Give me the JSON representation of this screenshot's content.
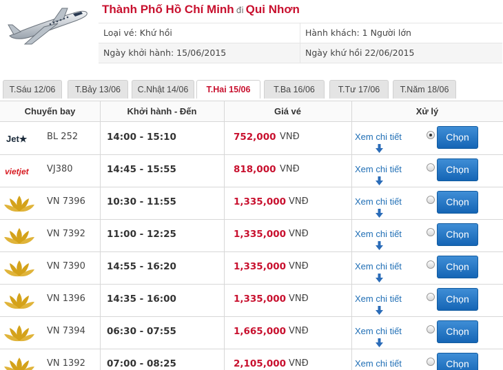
{
  "header": {
    "from_city": "Thành Phố Hồ Chí Minh",
    "connector": "đi",
    "to_city": "Qui Nhơn",
    "ticket_type": "Loại vé: Khứ hồi",
    "passengers": "Hành khách: 1 Người lớn",
    "depart_date": "Ngày khởi hành: 15/06/2015",
    "return_date": "Ngày khứ hồi 22/06/2015"
  },
  "tabs": [
    {
      "label": "T.Sáu 12/06",
      "active": false
    },
    {
      "label": "T.Bảy 13/06",
      "active": false
    },
    {
      "label": "C.Nhật 14/06",
      "active": false
    },
    {
      "label": "T.Hai 15/06",
      "active": true
    },
    {
      "label": "T.Ba 16/06",
      "active": false
    },
    {
      "label": "T.Tư 17/06",
      "active": false
    },
    {
      "label": "T.Năm 18/06",
      "active": false
    }
  ],
  "table": {
    "columns": [
      "Chuyến bay",
      "Khởi hành - Đến",
      "Giá vé",
      "Xử lý"
    ],
    "detail_label": "Xem chi tiết",
    "choose_label": "Chọn",
    "currency": "VNĐ",
    "rows": [
      {
        "airline": "jetstar",
        "flight": "BL 252",
        "time": "14:00 - 15:10",
        "price": "752,000",
        "selected": true
      },
      {
        "airline": "vietjet",
        "flight": "VJ380",
        "time": "14:45 - 15:55",
        "price": "818,000",
        "selected": false
      },
      {
        "airline": "vietnam-airlines",
        "flight": "VN 7396",
        "time": "10:30 - 11:55",
        "price": "1,335,000",
        "selected": false
      },
      {
        "airline": "vietnam-airlines",
        "flight": "VN 7392",
        "time": "11:00 - 12:25",
        "price": "1,335,000",
        "selected": false
      },
      {
        "airline": "vietnam-airlines",
        "flight": "VN 7390",
        "time": "14:55 - 16:20",
        "price": "1,335,000",
        "selected": false
      },
      {
        "airline": "vietnam-airlines",
        "flight": "VN 1396",
        "time": "14:35 - 16:00",
        "price": "1,335,000",
        "selected": false
      },
      {
        "airline": "vietnam-airlines",
        "flight": "VN 7394",
        "time": "06:30 - 07:55",
        "price": "1,665,000",
        "selected": false
      },
      {
        "airline": "vietnam-airlines",
        "flight": "VN 1392",
        "time": "07:00 - 08:25",
        "price": "2,105,000",
        "selected": false
      }
    ]
  },
  "logos": {
    "jetstar": "Jet★",
    "vietjet": "vietjet"
  },
  "colors": {
    "accent_red": "#c8102e",
    "link_blue": "#1f6eb5",
    "button_blue": "#1565b5",
    "vn_gold": "#d4a21a"
  }
}
